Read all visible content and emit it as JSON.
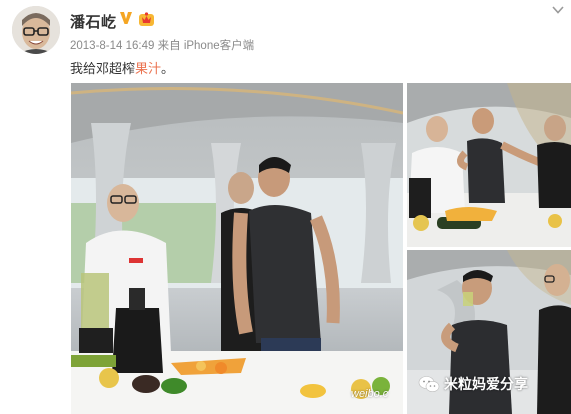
{
  "post": {
    "username": "潘石屹",
    "timestamp": "2013-8-14 16:49",
    "source_prefix": "来自",
    "source": "iPhone客户端",
    "text_before": "我给邓超榨",
    "text_highlight": "果汁",
    "text_after": "。"
  },
  "icons": {
    "verified": "verified-v-icon",
    "vip": "vip-crown-icon",
    "menu": "chevron-down-icon",
    "wechat": "wechat-icon"
  },
  "watermark": {
    "channel": "米粒妈爱分享",
    "site": "weibo.c"
  },
  "colors": {
    "highlight": "#eb7350",
    "verified": "#f5a623",
    "meta_text": "#8a8a8a"
  },
  "photos": [
    {
      "name": "photo-main",
      "subject": "man in white chef coat juicing fruit"
    },
    {
      "name": "photo-top-right",
      "subject": "man pointing at juicer"
    },
    {
      "name": "photo-bottom-right",
      "subject": "man drinking juice"
    }
  ]
}
